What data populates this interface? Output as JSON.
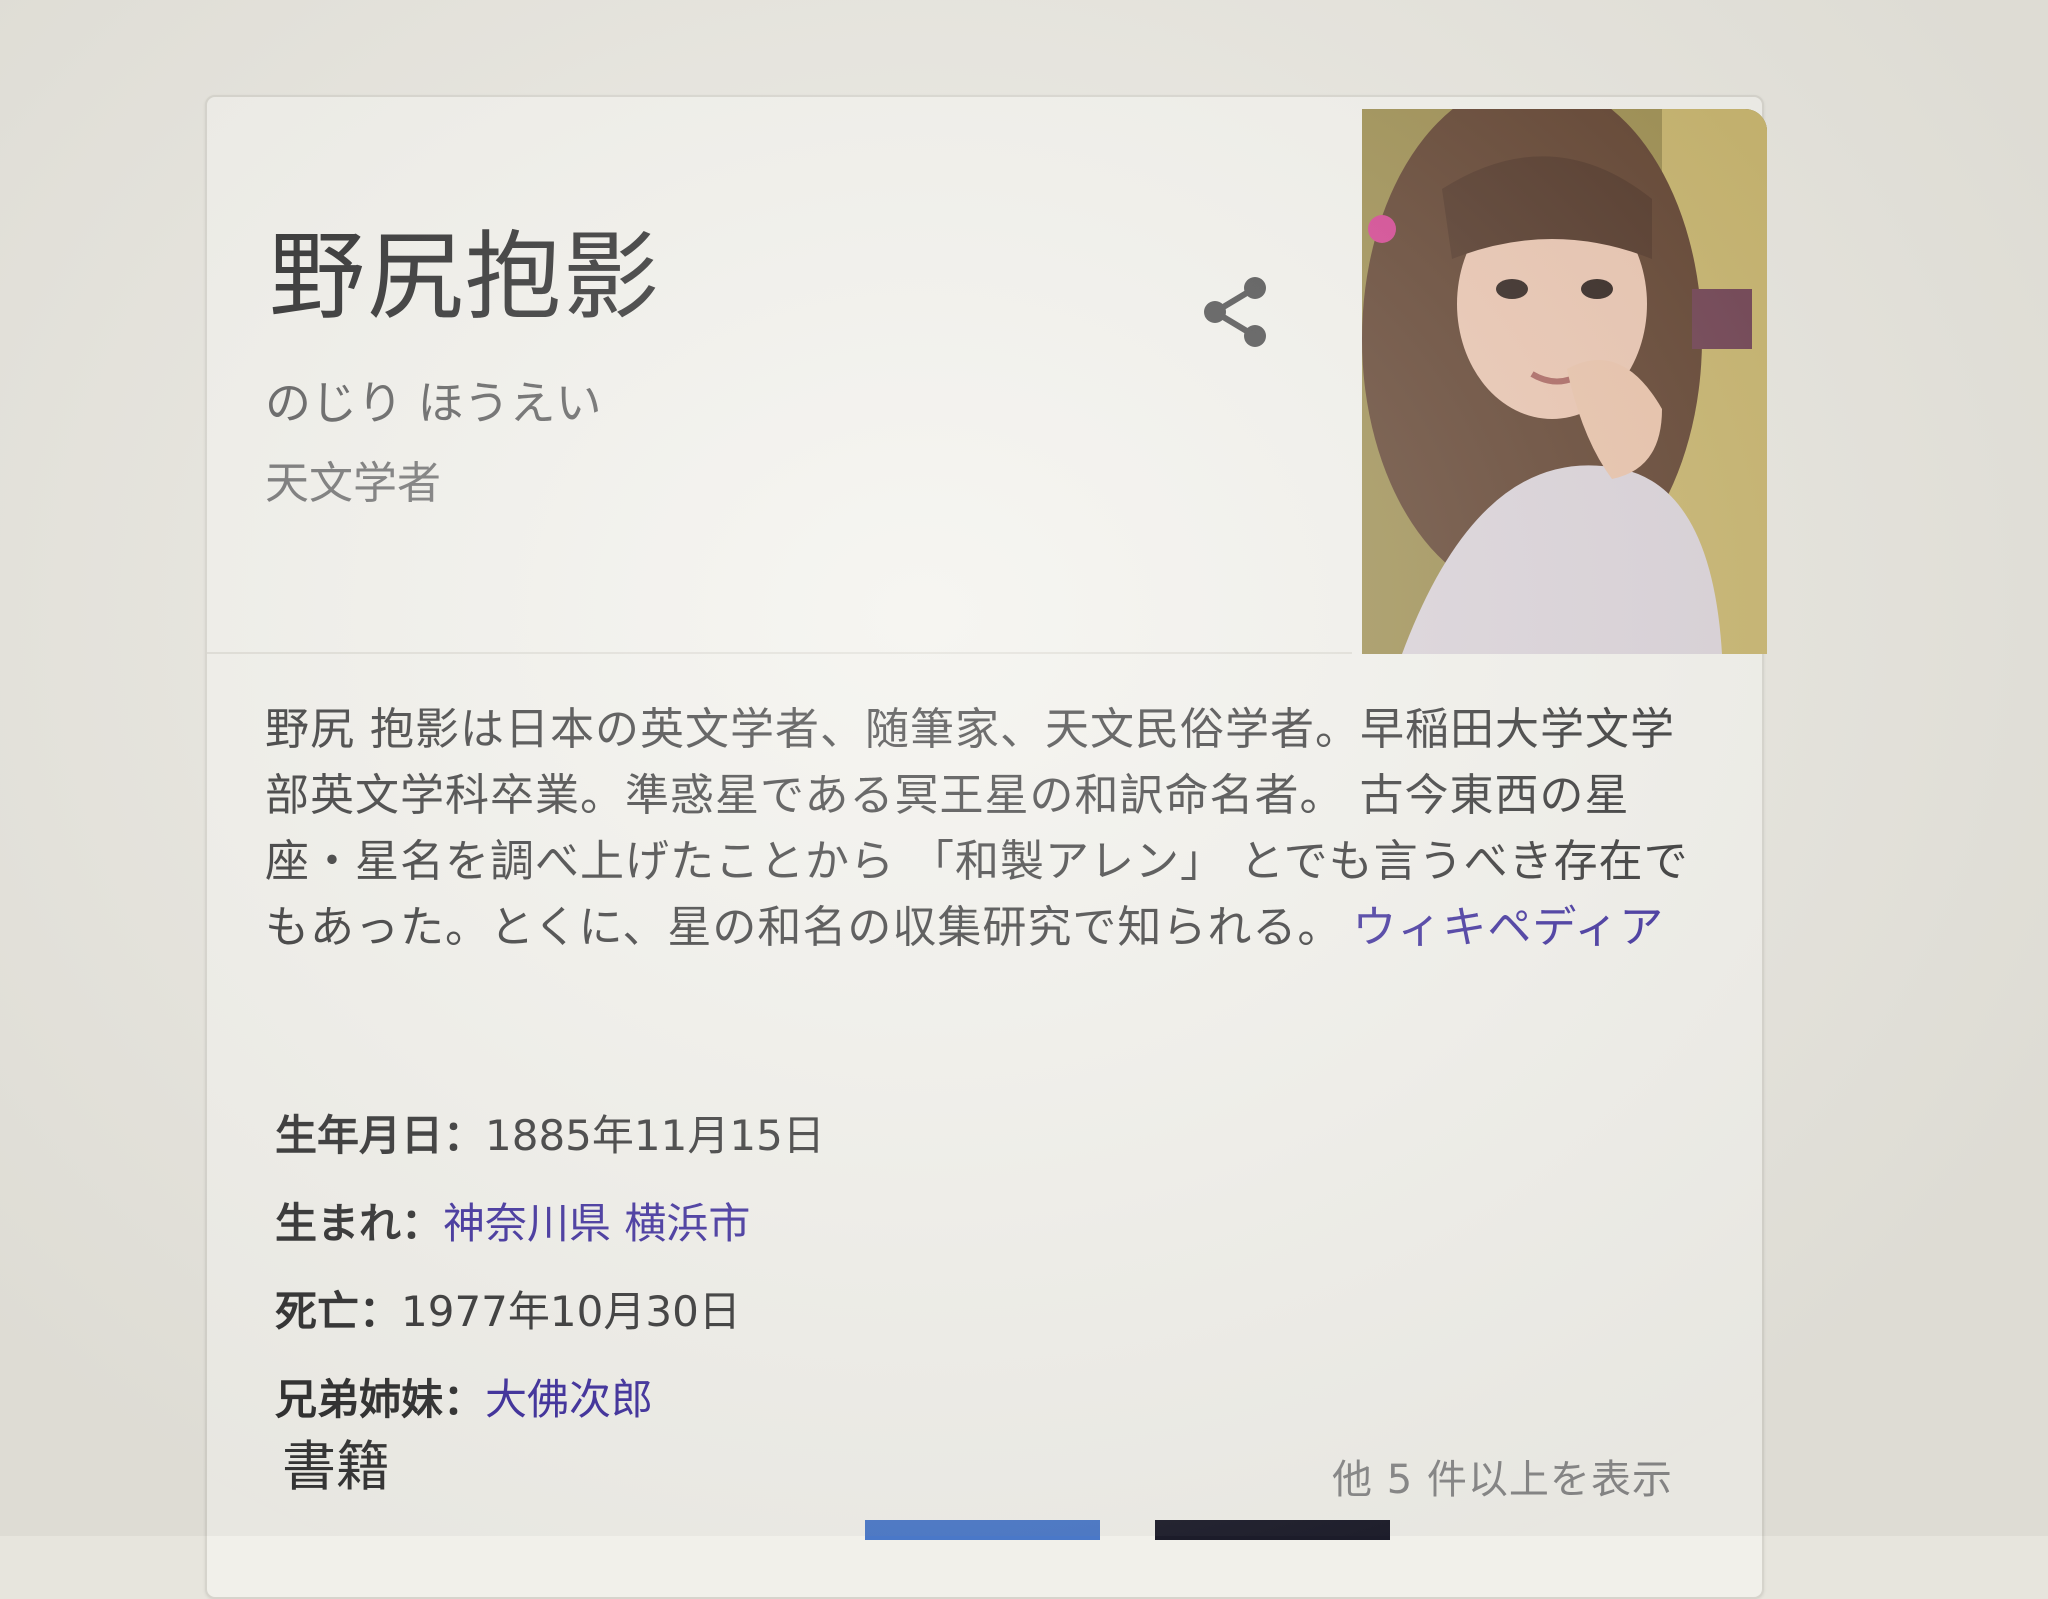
{
  "header": {
    "title": "野尻抱影",
    "reading": "のじり ほうえい",
    "subtitle": "天文学者",
    "share_icon": "share-icon"
  },
  "description": {
    "text": "野尻 抱影は日本の英文学者、随筆家、天文民俗学者。早稲田大学文学部英文学科卒業。準惑星である冥王星の和訳命名者。 古今東西の星座・星名を調べ上げたことから 「和製アレン」 とでも言うべき存在でもあった。とくに、星の和名の収集研究で知られる。",
    "source_link": "ウィキペディア"
  },
  "facts": [
    {
      "label": "生年月日：",
      "value": "1885年11月15日"
    },
    {
      "label": "生まれ：",
      "value": "神奈川県 横浜市"
    },
    {
      "label": "死亡：",
      "value": "1977年10月30日"
    },
    {
      "label": "兄弟姉妹：",
      "value": "大佛次郎"
    }
  ],
  "books": {
    "heading": "書籍",
    "more_link": "他 5 件以上を表示"
  },
  "colors": {
    "link": "#3a2a9a",
    "background": "#f1f0ea"
  }
}
